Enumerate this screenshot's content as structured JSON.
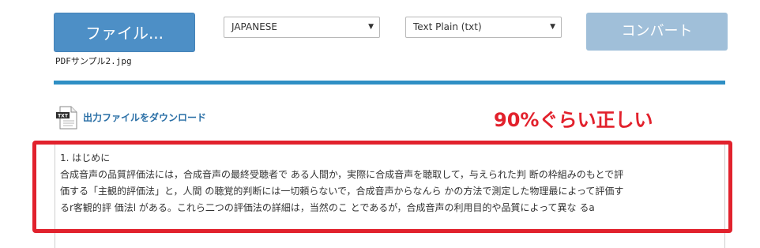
{
  "toolbar": {
    "file_button_label": "ファイル...",
    "selected_file": "PDFサンプル2.jpg",
    "language_select": "JAPANESE",
    "format_select": "Text Plain (txt)",
    "convert_button_label": "コンバート"
  },
  "progress": {
    "percent": 100
  },
  "result": {
    "download_label": "出力ファイルをダウンロード",
    "annotation": "90%ぐらい正しい",
    "text_lines": [
      "1. はじめに",
      "合成音声の品質評価法には，合成音声の最終受聴者で ある人間か，実際に合成音声を聴取して，与えられた判 断の枠組みのもとで評",
      "価する「主観的評価法」と，人間 の聴覚的判断には一切頼らないで，合成音声からなんら かの方法で測定した物理最によって評価す",
      "るr客観的評 価法l がある。これら二つの評価法の詳細は，当然のこ とであるが，合成音声の利用目的や品質によって異な るa"
    ]
  },
  "colors": {
    "file_button": "#4d8fc6",
    "convert_button_disabled": "#a0bfd9",
    "progress_bar": "#2f8fc4",
    "annotation_red": "#e2212c",
    "link_blue": "#2a6fa6"
  },
  "icons": {
    "download_icon": "txt-document-icon",
    "select_arrow": "chevron-down-icon"
  }
}
